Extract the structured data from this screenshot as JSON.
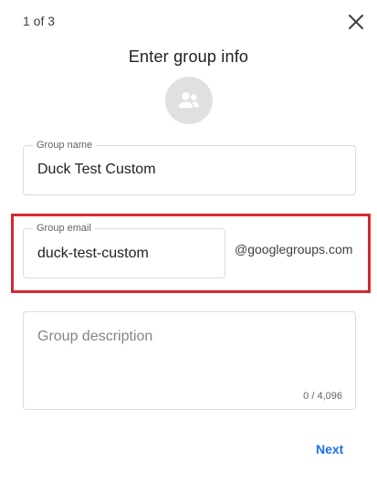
{
  "header": {
    "step": "1 of 3",
    "title": "Enter group info",
    "close_icon": "close-icon"
  },
  "avatar": {
    "icon": "group-icon"
  },
  "form": {
    "group_name": {
      "label": "Group name",
      "value": "Duck Test Custom"
    },
    "group_email": {
      "label": "Group email",
      "value": "duck-test-custom",
      "domain": "@googlegroups.com"
    },
    "group_description": {
      "placeholder": "Group description",
      "counter": "0 / 4,096"
    }
  },
  "footer": {
    "next_label": "Next"
  },
  "colors": {
    "accent": "#1a73e8",
    "highlight": "#d62830"
  }
}
